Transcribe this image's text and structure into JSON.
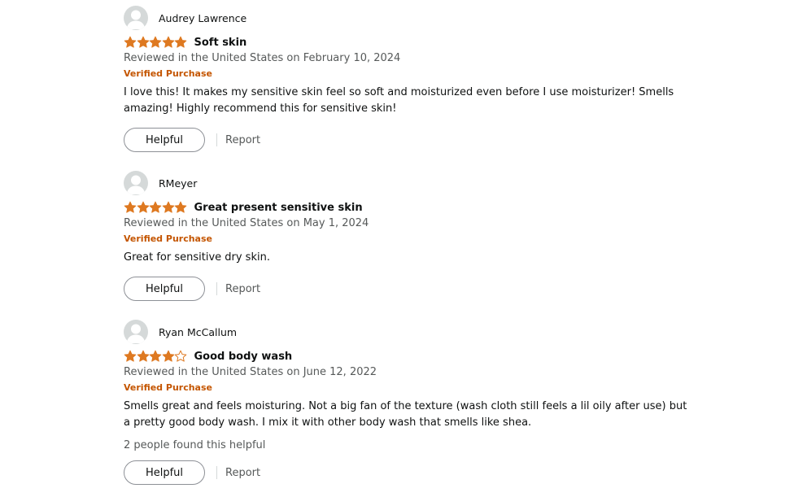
{
  "colors": {
    "star": "#de7921",
    "verified": "#c45500",
    "muted": "#565959"
  },
  "reviews": [
    {
      "author": "Audrey Lawrence",
      "rating": 5,
      "title": "Soft skin",
      "date": "Reviewed in the United States on February 10, 2024",
      "verified": "Verified Purchase",
      "body": "I love this! It makes my sensitive skin feel so soft and moisturized even before I use moisturizer! Smells amazing! Highly recommend this for sensitive skin!",
      "helpful_label": "Helpful",
      "report_label": "Report"
    },
    {
      "author": "RMeyer",
      "rating": 5,
      "title": "Great present sensitive skin",
      "date": "Reviewed in the United States on May 1, 2024",
      "verified": "Verified Purchase",
      "body": "Great for sensitive dry skin.",
      "helpful_label": "Helpful",
      "report_label": "Report"
    },
    {
      "author": "Ryan McCallum",
      "rating": 4,
      "title": "Good body wash",
      "date": "Reviewed in the United States on June 12, 2022",
      "verified": "Verified Purchase",
      "body": "Smells great and feels moisturing. Not a big fan of the texture (wash cloth still feels a lil oily after use) but a pretty good body wash. I mix it with other body wash that smells like shea.",
      "found_helpful": "2 people found this helpful",
      "helpful_label": "Helpful",
      "report_label": "Report"
    }
  ]
}
